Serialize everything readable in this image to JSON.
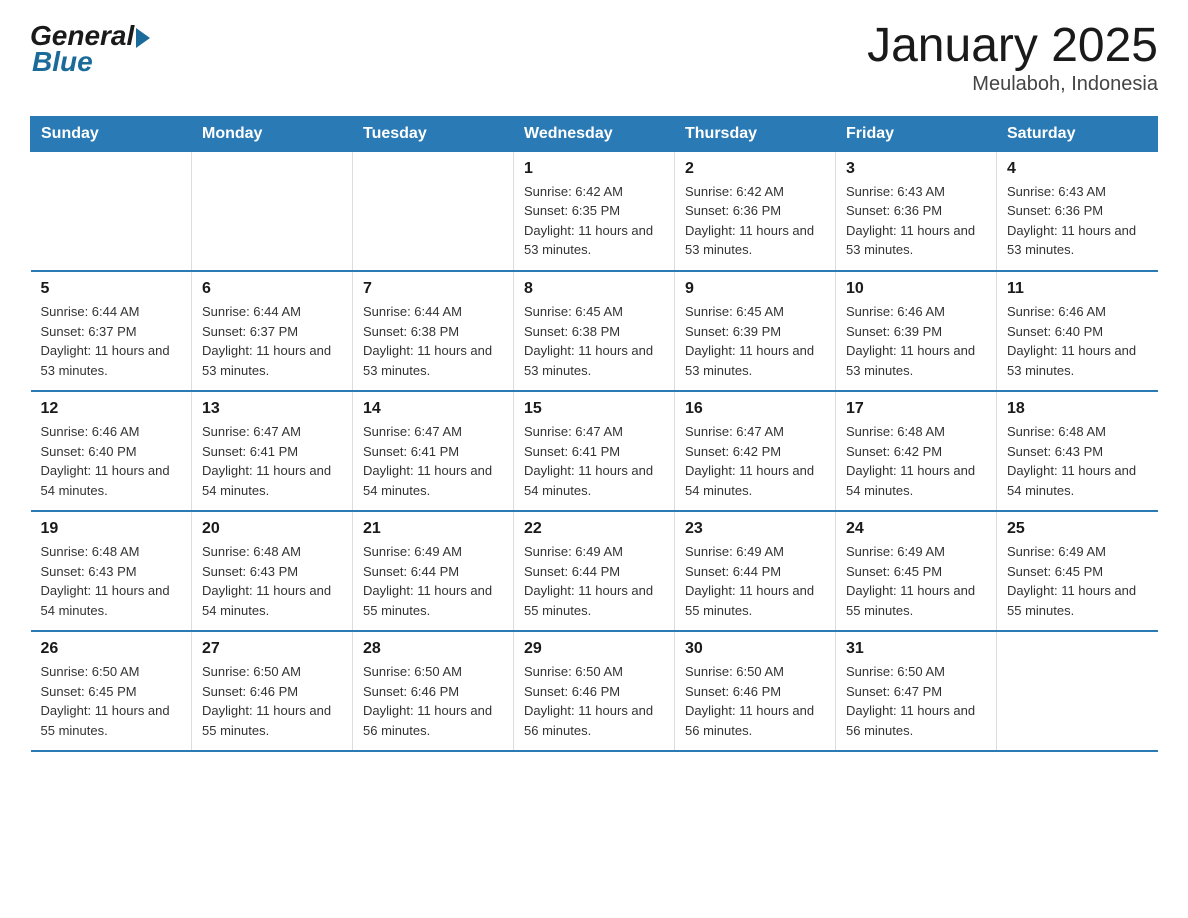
{
  "logo": {
    "general": "General",
    "blue": "Blue"
  },
  "title": "January 2025",
  "subtitle": "Meulaboh, Indonesia",
  "days_of_week": [
    "Sunday",
    "Monday",
    "Tuesday",
    "Wednesday",
    "Thursday",
    "Friday",
    "Saturday"
  ],
  "weeks": [
    [
      {
        "day": "",
        "info": ""
      },
      {
        "day": "",
        "info": ""
      },
      {
        "day": "",
        "info": ""
      },
      {
        "day": "1",
        "info": "Sunrise: 6:42 AM\nSunset: 6:35 PM\nDaylight: 11 hours and 53 minutes."
      },
      {
        "day": "2",
        "info": "Sunrise: 6:42 AM\nSunset: 6:36 PM\nDaylight: 11 hours and 53 minutes."
      },
      {
        "day": "3",
        "info": "Sunrise: 6:43 AM\nSunset: 6:36 PM\nDaylight: 11 hours and 53 minutes."
      },
      {
        "day": "4",
        "info": "Sunrise: 6:43 AM\nSunset: 6:36 PM\nDaylight: 11 hours and 53 minutes."
      }
    ],
    [
      {
        "day": "5",
        "info": "Sunrise: 6:44 AM\nSunset: 6:37 PM\nDaylight: 11 hours and 53 minutes."
      },
      {
        "day": "6",
        "info": "Sunrise: 6:44 AM\nSunset: 6:37 PM\nDaylight: 11 hours and 53 minutes."
      },
      {
        "day": "7",
        "info": "Sunrise: 6:44 AM\nSunset: 6:38 PM\nDaylight: 11 hours and 53 minutes."
      },
      {
        "day": "8",
        "info": "Sunrise: 6:45 AM\nSunset: 6:38 PM\nDaylight: 11 hours and 53 minutes."
      },
      {
        "day": "9",
        "info": "Sunrise: 6:45 AM\nSunset: 6:39 PM\nDaylight: 11 hours and 53 minutes."
      },
      {
        "day": "10",
        "info": "Sunrise: 6:46 AM\nSunset: 6:39 PM\nDaylight: 11 hours and 53 minutes."
      },
      {
        "day": "11",
        "info": "Sunrise: 6:46 AM\nSunset: 6:40 PM\nDaylight: 11 hours and 53 minutes."
      }
    ],
    [
      {
        "day": "12",
        "info": "Sunrise: 6:46 AM\nSunset: 6:40 PM\nDaylight: 11 hours and 54 minutes."
      },
      {
        "day": "13",
        "info": "Sunrise: 6:47 AM\nSunset: 6:41 PM\nDaylight: 11 hours and 54 minutes."
      },
      {
        "day": "14",
        "info": "Sunrise: 6:47 AM\nSunset: 6:41 PM\nDaylight: 11 hours and 54 minutes."
      },
      {
        "day": "15",
        "info": "Sunrise: 6:47 AM\nSunset: 6:41 PM\nDaylight: 11 hours and 54 minutes."
      },
      {
        "day": "16",
        "info": "Sunrise: 6:47 AM\nSunset: 6:42 PM\nDaylight: 11 hours and 54 minutes."
      },
      {
        "day": "17",
        "info": "Sunrise: 6:48 AM\nSunset: 6:42 PM\nDaylight: 11 hours and 54 minutes."
      },
      {
        "day": "18",
        "info": "Sunrise: 6:48 AM\nSunset: 6:43 PM\nDaylight: 11 hours and 54 minutes."
      }
    ],
    [
      {
        "day": "19",
        "info": "Sunrise: 6:48 AM\nSunset: 6:43 PM\nDaylight: 11 hours and 54 minutes."
      },
      {
        "day": "20",
        "info": "Sunrise: 6:48 AM\nSunset: 6:43 PM\nDaylight: 11 hours and 54 minutes."
      },
      {
        "day": "21",
        "info": "Sunrise: 6:49 AM\nSunset: 6:44 PM\nDaylight: 11 hours and 55 minutes."
      },
      {
        "day": "22",
        "info": "Sunrise: 6:49 AM\nSunset: 6:44 PM\nDaylight: 11 hours and 55 minutes."
      },
      {
        "day": "23",
        "info": "Sunrise: 6:49 AM\nSunset: 6:44 PM\nDaylight: 11 hours and 55 minutes."
      },
      {
        "day": "24",
        "info": "Sunrise: 6:49 AM\nSunset: 6:45 PM\nDaylight: 11 hours and 55 minutes."
      },
      {
        "day": "25",
        "info": "Sunrise: 6:49 AM\nSunset: 6:45 PM\nDaylight: 11 hours and 55 minutes."
      }
    ],
    [
      {
        "day": "26",
        "info": "Sunrise: 6:50 AM\nSunset: 6:45 PM\nDaylight: 11 hours and 55 minutes."
      },
      {
        "day": "27",
        "info": "Sunrise: 6:50 AM\nSunset: 6:46 PM\nDaylight: 11 hours and 55 minutes."
      },
      {
        "day": "28",
        "info": "Sunrise: 6:50 AM\nSunset: 6:46 PM\nDaylight: 11 hours and 56 minutes."
      },
      {
        "day": "29",
        "info": "Sunrise: 6:50 AM\nSunset: 6:46 PM\nDaylight: 11 hours and 56 minutes."
      },
      {
        "day": "30",
        "info": "Sunrise: 6:50 AM\nSunset: 6:46 PM\nDaylight: 11 hours and 56 minutes."
      },
      {
        "day": "31",
        "info": "Sunrise: 6:50 AM\nSunset: 6:47 PM\nDaylight: 11 hours and 56 minutes."
      },
      {
        "day": "",
        "info": ""
      }
    ]
  ]
}
